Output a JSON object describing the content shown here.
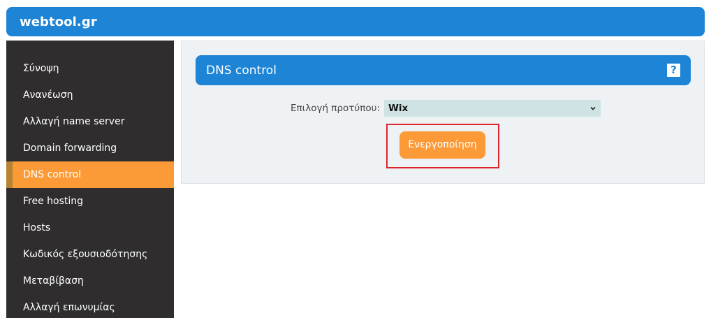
{
  "header": {
    "brand": "webtool.gr"
  },
  "sidebar": {
    "items": [
      {
        "label": "Σύνοψη",
        "active": false
      },
      {
        "label": "Ανανέωση",
        "active": false
      },
      {
        "label": "Αλλαγή name server",
        "active": false
      },
      {
        "label": "Domain forwarding",
        "active": false
      },
      {
        "label": "DNS control",
        "active": true
      },
      {
        "label": "Free hosting",
        "active": false
      },
      {
        "label": "Hosts",
        "active": false
      },
      {
        "label": "Κωδικός εξουσιοδότησης",
        "active": false
      },
      {
        "label": "Μεταβίβαση",
        "active": false
      },
      {
        "label": "Αλλαγή επωνυμίας",
        "active": false
      }
    ]
  },
  "panel": {
    "title": "DNS control",
    "help_icon": "?",
    "template_label": "Επιλογή προτύπου:",
    "template_value": "Wix",
    "activate_label": "Ενεργοποίηση"
  },
  "colors": {
    "brand_blue": "#1d84d6",
    "sidebar_bg": "#2f2d2e",
    "active_orange": "#fc9a38",
    "highlight_red": "#d9252b",
    "select_bg": "#cfe3e4"
  },
  "icons": {
    "help": "question-mark-icon",
    "select": "chevron-down-icon"
  }
}
